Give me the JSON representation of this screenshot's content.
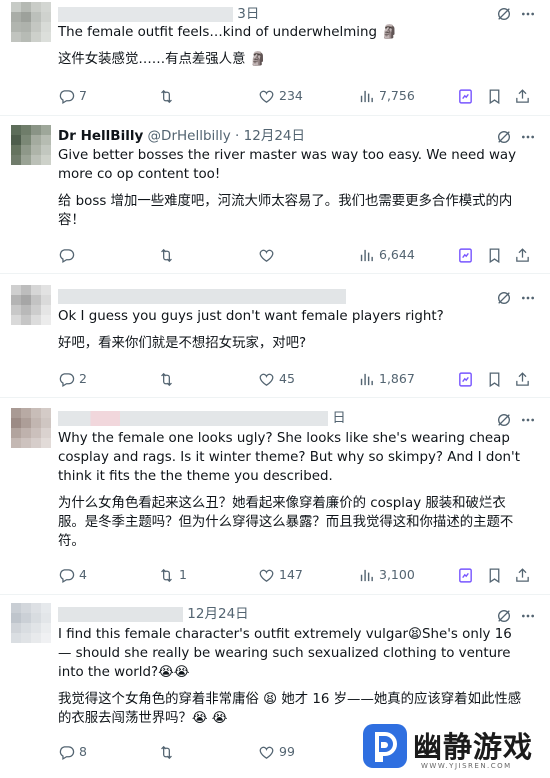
{
  "tweets": [
    {
      "date": "3日",
      "lines": [
        "The female outfit feels…kind of underwhelming 🗿",
        "这件女装感觉……有点差强人意 🗿"
      ],
      "stats": {
        "replies": "7",
        "reposts": "",
        "likes": "234",
        "views": "7,756"
      }
    },
    {
      "name": "Dr HellBilly",
      "handle": "@DrHellbilly · 12月24日",
      "lines": [
        "Give better bosses the river master was way too easy. We need way more co op content too!",
        "给 boss 增加一些难度吧，河流大师太容易了。我们也需要更多合作模式的内容！"
      ],
      "stats": {
        "replies": "",
        "reposts": "",
        "likes": "",
        "views": "6,644"
      }
    },
    {
      "lines": [
        "Ok I guess you guys just don't want female players right?",
        "好吧，看来你们就是不想招女玩家，对吧?"
      ],
      "stats": {
        "replies": "2",
        "reposts": "",
        "likes": "45",
        "views": "1,867"
      }
    },
    {
      "date": "日",
      "lines": [
        "Why the female one looks ugly? She looks like she's wearing cheap cosplay and rags. Is it winter theme? But why so skimpy? And I don't think it fits the the theme you described.",
        "为什么女角色看起来这么丑？她看起来像穿着廉价的 cosplay 服装和破烂衣服。是冬季主题吗？但为什么穿得这么暴露？而且我觉得这和你描述的主题不符。"
      ],
      "stats": {
        "replies": "4",
        "reposts": "1",
        "likes": "147",
        "views": "3,100"
      }
    },
    {
      "date": "12月24日",
      "lines": [
        "I find this female character's outfit extremely vulgar😫She's only 16 — should she really be wearing such sexualized clothing to venture into the world?😭😭",
        "我觉得这个女角色的穿着非常庸俗 😫 她才 16 岁——她真的应该穿着如此性感的衣服去闯荡世界吗？😭 😭"
      ],
      "stats": {
        "replies": "8",
        "reposts": "",
        "likes": "99",
        "views": ""
      }
    }
  ],
  "watermark": {
    "title": "幽静游戏",
    "url": "WWW.YJISREN.COM"
  },
  "icons": [
    "grok-icon",
    "more-icon",
    "reply-icon",
    "repost-icon",
    "like-icon",
    "views-icon",
    "grok-analyze-icon",
    "bookmark-icon",
    "share-icon"
  ],
  "colors": {
    "text": "#0f1419",
    "muted": "#536471",
    "accent_purple": "#7856ff",
    "divider": "#eff3f4"
  }
}
